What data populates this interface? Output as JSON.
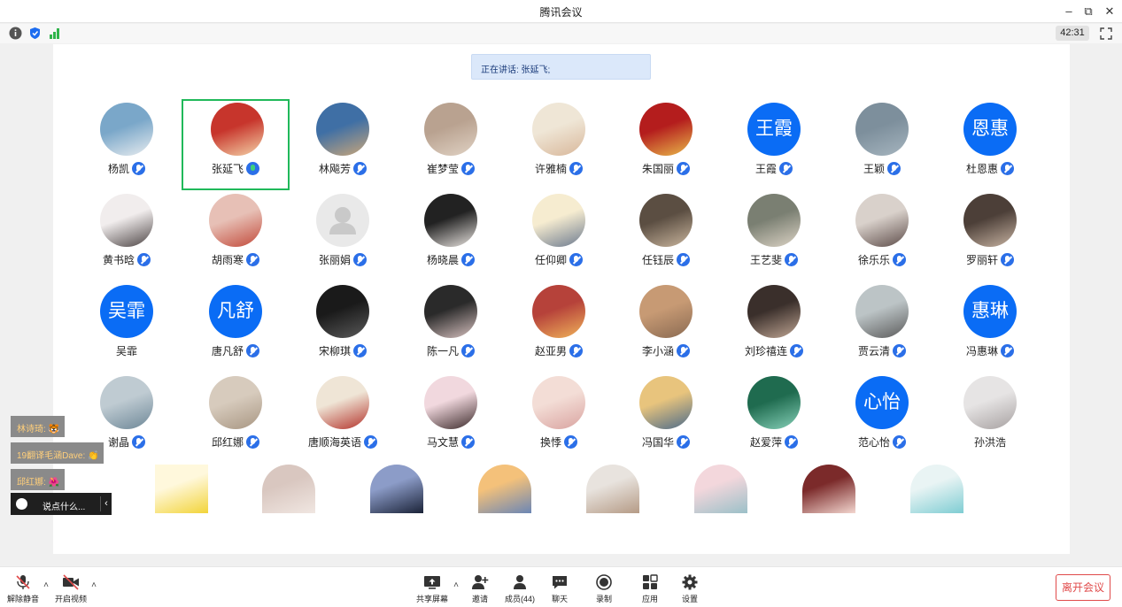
{
  "window": {
    "title": "腾讯会议"
  },
  "status": {
    "timer": "42:31"
  },
  "speaking": "正在讲话: 张延飞;",
  "participants": [
    {
      "name": "杨凯",
      "avatar": "photo"
    },
    {
      "name": "张延飞",
      "avatar": "photo",
      "talking": true
    },
    {
      "name": "林飚芳",
      "avatar": "photo"
    },
    {
      "name": "崔梦莹",
      "avatar": "photo"
    },
    {
      "name": "许雅楠",
      "avatar": "photo"
    },
    {
      "name": "朱国丽",
      "avatar": "photo"
    },
    {
      "name": "王霞",
      "avatar": "text",
      "initials": "王霞"
    },
    {
      "name": "王颖",
      "avatar": "photo"
    },
    {
      "name": "杜恩惠",
      "avatar": "text",
      "initials": "恩惠"
    },
    {
      "name": "黄书晗",
      "avatar": "photo"
    },
    {
      "name": "胡雨寒",
      "avatar": "photo"
    },
    {
      "name": "张丽娟",
      "avatar": "default"
    },
    {
      "name": "杨晓晨",
      "avatar": "photo"
    },
    {
      "name": "任仰卿",
      "avatar": "photo"
    },
    {
      "name": "任钰辰",
      "avatar": "photo"
    },
    {
      "name": "王艺斐",
      "avatar": "photo"
    },
    {
      "name": "徐乐乐",
      "avatar": "photo"
    },
    {
      "name": "罗丽轩",
      "avatar": "photo"
    },
    {
      "name": "吴霏",
      "avatar": "text",
      "initials": "吴霏",
      "nomic": true
    },
    {
      "name": "唐凡舒",
      "avatar": "text",
      "initials": "凡舒"
    },
    {
      "name": "宋柳琪",
      "avatar": "photo"
    },
    {
      "name": "陈一凡",
      "avatar": "photo"
    },
    {
      "name": "赵亚男",
      "avatar": "photo"
    },
    {
      "name": "李小涵",
      "avatar": "photo"
    },
    {
      "name": "刘珍禧连",
      "avatar": "photo"
    },
    {
      "name": "贾云清",
      "avatar": "photo"
    },
    {
      "name": "冯惠琳",
      "avatar": "text",
      "initials": "惠琳"
    },
    {
      "name": "谢晶",
      "avatar": "photo"
    },
    {
      "name": "邱红娜",
      "avatar": "photo"
    },
    {
      "name": "唐顺海英语",
      "avatar": "photo"
    },
    {
      "name": "马文慧",
      "avatar": "photo"
    },
    {
      "name": "换悸",
      "avatar": "photo"
    },
    {
      "name": "冯国华",
      "avatar": "photo"
    },
    {
      "name": "赵爱萍",
      "avatar": "photo"
    },
    {
      "name": "范心怡",
      "avatar": "text",
      "initials": "心怡"
    },
    {
      "name": "孙洪浩",
      "avatar": "photo",
      "nomic": true
    }
  ],
  "chat": {
    "messages": [
      {
        "text": "林诗琦: ",
        "emoji": "🐯"
      },
      {
        "text": "19翻译毛涵Dave: ",
        "emoji": "👏"
      },
      {
        "text": "邱红娜: ",
        "emoji": "🌺"
      }
    ],
    "input_placeholder": "说点什么..."
  },
  "toolbar": {
    "unmute": "解除静音",
    "video": "开启视频",
    "share": "共享屏幕",
    "invite": "邀请",
    "members": "成员(44)",
    "chat": "聊天",
    "record": "录制",
    "apps": "应用",
    "settings": "设置",
    "leave": "离开会议"
  },
  "colors": {
    "accent": "#0a6cf5",
    "active_border": "#20b95a",
    "leave": "#e04a4a"
  },
  "icons": [
    "info-icon",
    "shield-icon",
    "signal-icon",
    "fullscreen-icon",
    "mic-muted-icon",
    "video-off-icon",
    "share-screen-icon",
    "invite-icon",
    "members-icon",
    "chat-icon",
    "record-icon",
    "apps-icon",
    "settings-icon"
  ]
}
